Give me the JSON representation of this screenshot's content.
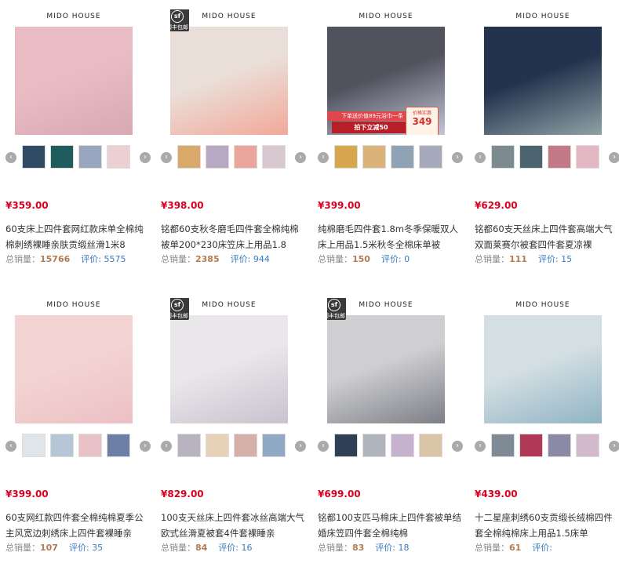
{
  "brand_name": "MIDO HOUSE",
  "sf_badge": {
    "logo": "sf",
    "text": "顺丰包邮"
  },
  "stats_labels": {
    "sales": "总销量：",
    "reviews": "评价: "
  },
  "promo": {
    "line1": "下单送价值89元浴巾一条",
    "line2": "拍下立减50",
    "badge_top": "价格实惠",
    "badge_price": "349"
  },
  "colors": {
    "price": "#d8001e",
    "sales": "#b37b53",
    "reviews": "#3a7bbf",
    "badge": "#3a3a3a"
  },
  "products": [
    {
      "price": "¥359.00",
      "title": "60支床上四件套网红款床单全棉纯棉刺绣裸睡亲肤贡缎丝滑1米8",
      "sales": "15766",
      "reviews": "5575",
      "sf_badge": false,
      "promo": false,
      "img": [
        "#e9bcc4",
        "#d9a8b2"
      ],
      "thumbs": [
        "#2f4a63",
        "#1e5c5e",
        "#9aa6bf",
        "#eccfd3"
      ]
    },
    {
      "price": "¥398.00",
      "title": "铭都60支秋冬磨毛四件套全棉纯棉被单200*230床笠床上用品1.8",
      "sales": "2385",
      "reviews": "944",
      "sf_badge": true,
      "promo": false,
      "img": [
        "#eadfd8",
        "#f2a89a"
      ],
      "thumbs": [
        "#d9a96a",
        "#b9a8c4",
        "#eaa59d",
        "#d8c8d0"
      ]
    },
    {
      "price": "¥399.00",
      "title": "纯棉磨毛四件套1.8m冬季保暖双人床上用品1.5米秋冬全棉床单被",
      "sales": "150",
      "reviews": "0",
      "sf_badge": false,
      "promo": true,
      "img": [
        "#51525e",
        "#c4c6d6"
      ],
      "thumbs": [
        "#d8a64e",
        "#d9b37a",
        "#8fa3b5",
        "#a7a9bd"
      ]
    },
    {
      "price": "¥629.00",
      "title": "铭都60支天丝床上四件套高端大气双面莱赛尔被套四件套夏凉裸",
      "sales": "111",
      "reviews": "15",
      "sf_badge": false,
      "promo": false,
      "img": [
        "#23334e",
        "#8fa2a5"
      ],
      "thumbs": [
        "#7c8b8f",
        "#4b6470",
        "#c27a86",
        "#e4b8c3"
      ]
    },
    {
      "price": "¥399.00",
      "title": "60支网红款四件套全棉纯棉夏季公主风宽边刺绣床上四件套裸睡亲",
      "sales": "107",
      "reviews": "35",
      "sf_badge": false,
      "promo": false,
      "img": [
        "#f3d4d2",
        "#ecc0c4"
      ],
      "thumbs": [
        "#e0e5ea",
        "#b6c6d6",
        "#e9c1c6",
        "#6e7fa5"
      ]
    },
    {
      "price": "¥829.00",
      "title": "100支天丝床上四件套冰丝高端大气欧式丝滑夏被套4件套裸睡亲",
      "sales": "84",
      "reviews": "16",
      "sf_badge": true,
      "promo": false,
      "img": [
        "#eae7eb",
        "#c9c2cd"
      ],
      "thumbs": [
        "#b9b2c1",
        "#e7d2b7",
        "#d4b0a6",
        "#8fa9c4"
      ]
    },
    {
      "price": "¥699.00",
      "title": "铭都100支匹马棉床上四件套被单结婚床笠四件套全棉纯棉",
      "sales": "83",
      "reviews": "18",
      "sf_badge": true,
      "promo": false,
      "img": [
        "#cfcfd2",
        "#7d7f86"
      ],
      "thumbs": [
        "#2e3f56",
        "#b0b4bd",
        "#c6b2cf",
        "#d9c4a5"
      ]
    },
    {
      "price": "¥439.00",
      "title": "十二星座刺绣60支贡缎长绒棉四件套全棉纯棉床上用品1.5床单",
      "sales": "61",
      "reviews": "",
      "sf_badge": false,
      "promo": false,
      "img": [
        "#d4dfe3",
        "#90b4c4"
      ],
      "thumbs": [
        "#7e8a96",
        "#b03a56",
        "#8a8aa6",
        "#d2b9cc"
      ]
    }
  ]
}
